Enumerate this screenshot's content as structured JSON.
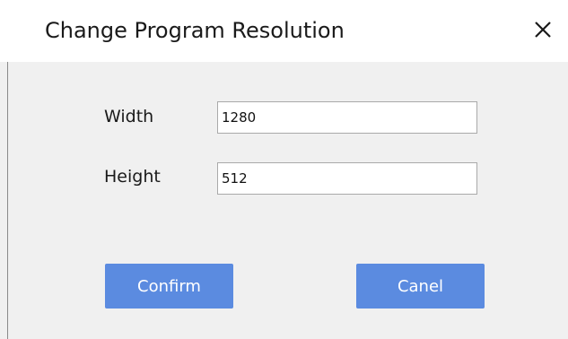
{
  "dialog": {
    "title": "Change Program Resolution",
    "close_icon": "close-icon"
  },
  "form": {
    "width_label": "Width",
    "width_value": "1280",
    "height_label": "Height",
    "height_value": "512"
  },
  "buttons": {
    "confirm_label": "Confirm",
    "cancel_label": "Canel"
  },
  "colors": {
    "button_bg": "#5b8be0",
    "titlebar_bg": "#ffffff",
    "body_bg": "#f0f0f0"
  }
}
